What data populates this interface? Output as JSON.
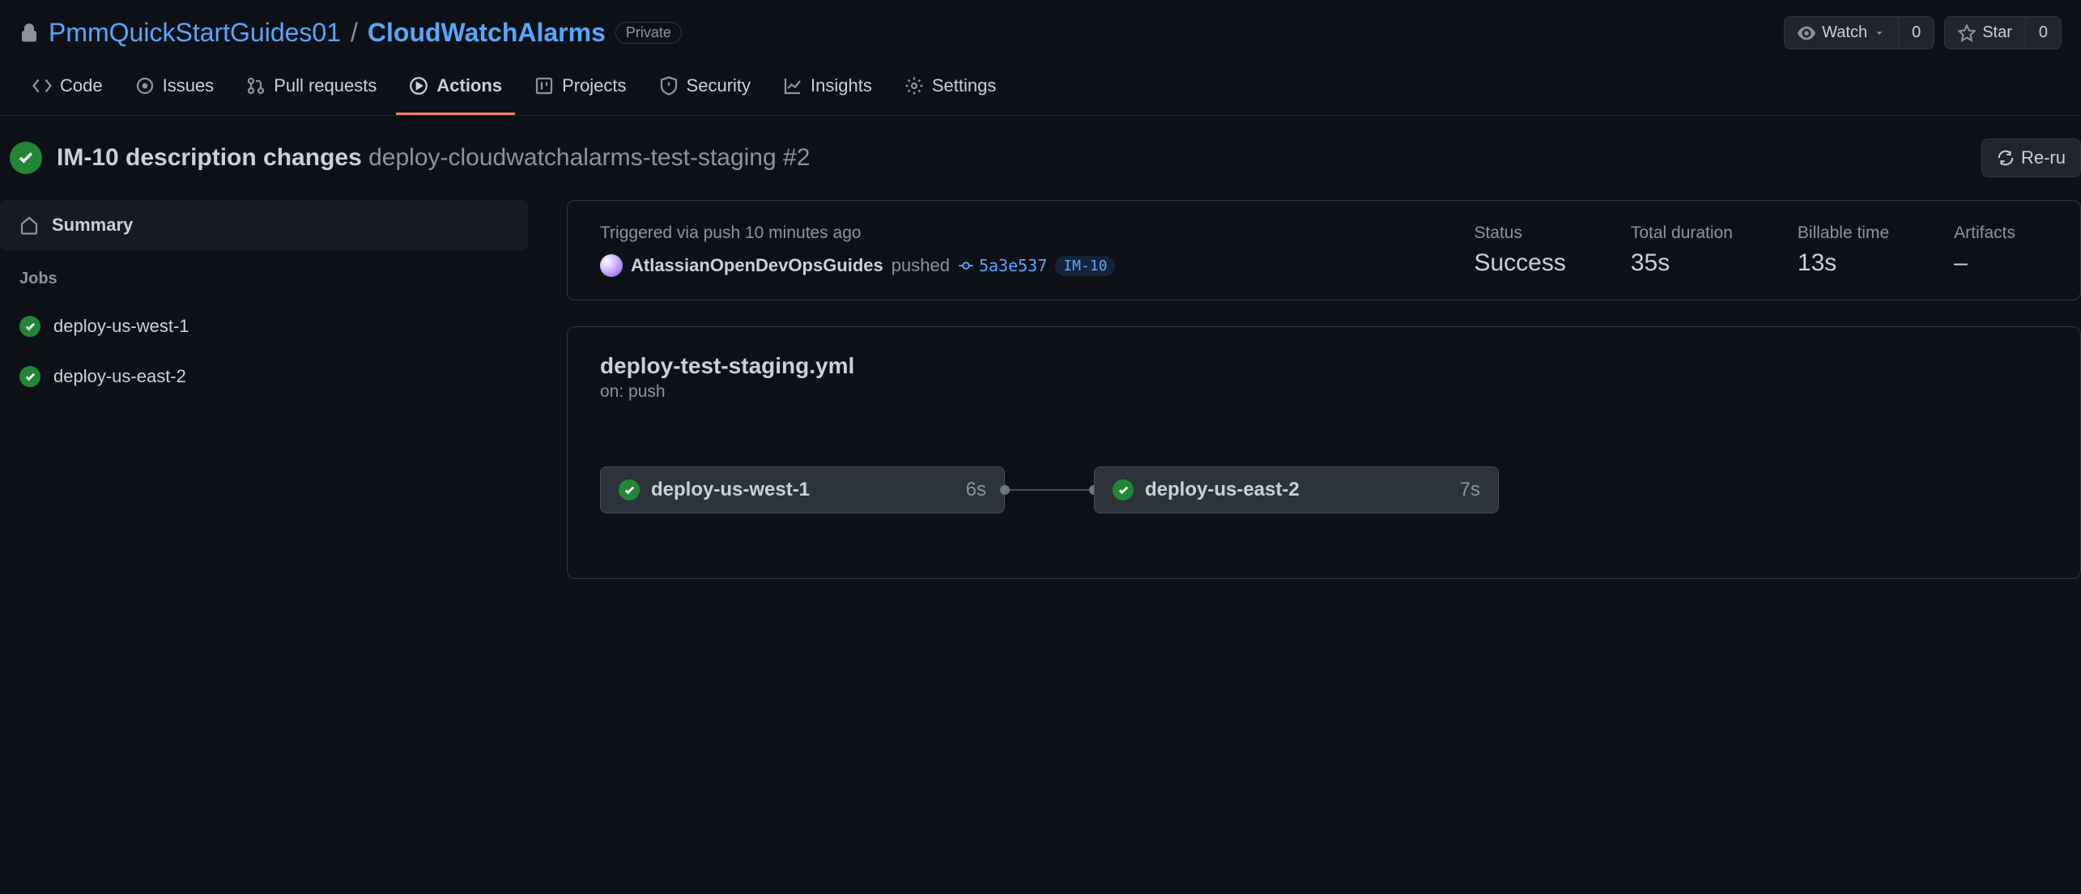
{
  "breadcrumb": {
    "owner": "PmmQuickStartGuides01",
    "repo": "CloudWatchAlarms",
    "visibility": "Private"
  },
  "headerActions": {
    "watch": "Watch",
    "watchCount": "0",
    "star": "Star",
    "starCount": "0"
  },
  "tabs": {
    "code": "Code",
    "issues": "Issues",
    "pulls": "Pull requests",
    "actions": "Actions",
    "projects": "Projects",
    "security": "Security",
    "insights": "Insights",
    "settings": "Settings"
  },
  "run": {
    "title": "IM-10 description changes",
    "workflow": "deploy-cloudwatchalarms-test-staging #2",
    "rerun": "Re-ru"
  },
  "sidebar": {
    "summary": "Summary",
    "jobsLabel": "Jobs",
    "jobs": [
      {
        "name": "deploy-us-west-1"
      },
      {
        "name": "deploy-us-east-2"
      }
    ]
  },
  "summary": {
    "triggered": "Triggered via push 10 minutes ago",
    "author": "AtlassianOpenDevOpsGuides",
    "pushed": "pushed",
    "sha": "5a3e537",
    "issue": "IM-10",
    "statusLabel": "Status",
    "statusValue": "Success",
    "durationLabel": "Total duration",
    "durationValue": "35s",
    "billableLabel": "Billable time",
    "billableValue": "13s",
    "artifactsLabel": "Artifacts",
    "artifactsValue": "–"
  },
  "workflowCard": {
    "file": "deploy-test-staging.yml",
    "on": "on: push",
    "nodes": [
      {
        "name": "deploy-us-west-1",
        "time": "6s"
      },
      {
        "name": "deploy-us-east-2",
        "time": "7s"
      }
    ]
  }
}
